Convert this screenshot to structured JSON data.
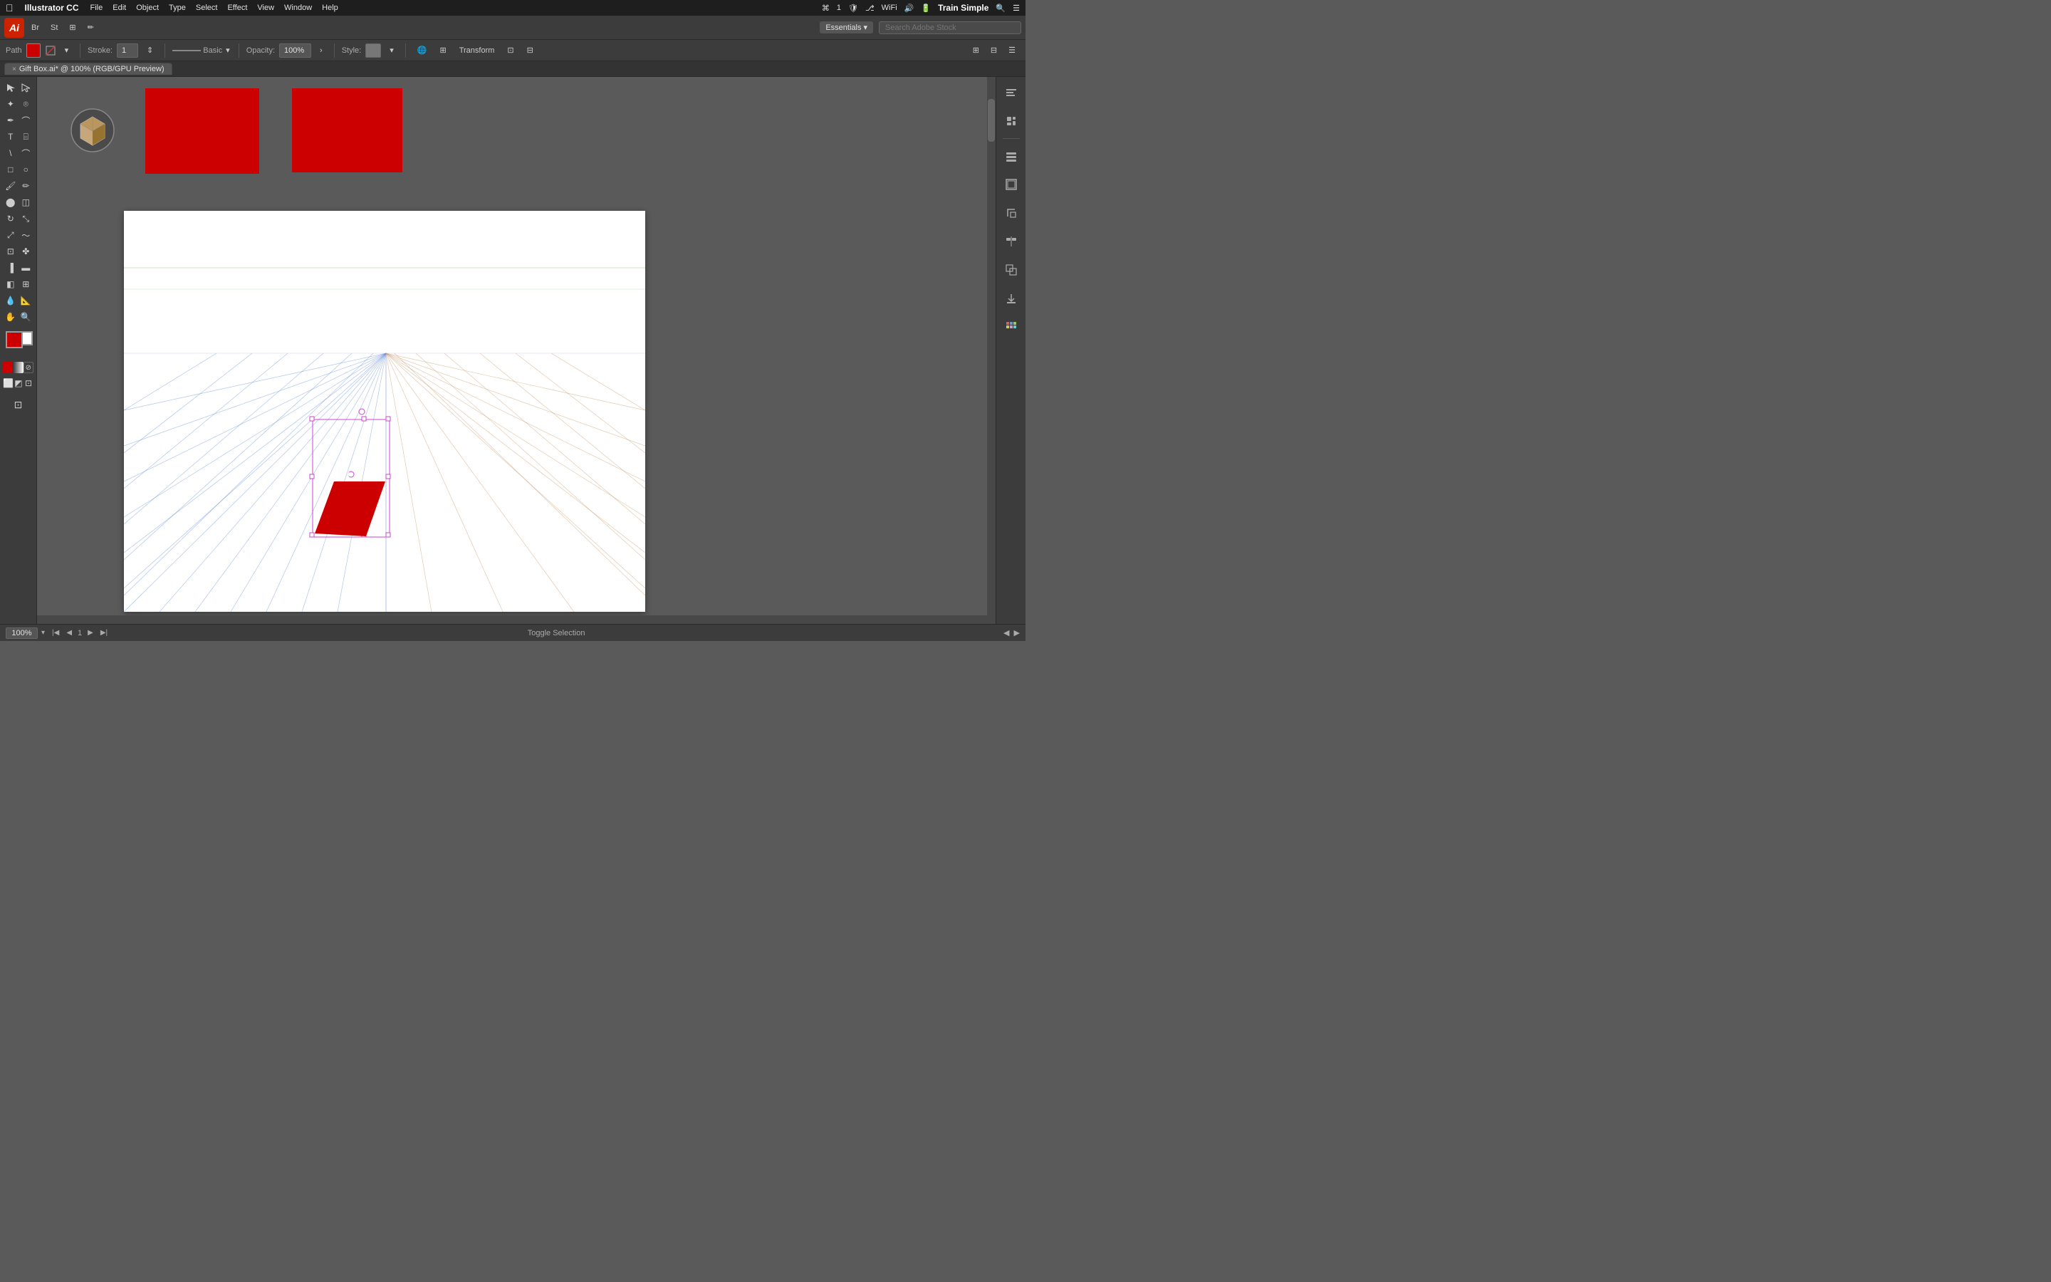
{
  "menubar": {
    "apple": "⌘",
    "app_name": "Illustrator CC",
    "menus": [
      "File",
      "Edit",
      "Object",
      "Type",
      "Select",
      "Effect",
      "View",
      "Window",
      "Help"
    ],
    "right": {
      "wifi": "WiFi",
      "battery": "🔋",
      "train_simple": "Train Simple",
      "search_icon": "🔍",
      "menu_icon": "☰"
    }
  },
  "top_toolbar": {
    "logo": "Ai",
    "bridge_btn": "Br",
    "stock_btn": "St",
    "arrange_btn": "⊞",
    "essentials_label": "Essentials",
    "search_placeholder": "Search Adobe Stock"
  },
  "properties_bar": {
    "label": "Path",
    "fill_color": "#cc0000",
    "stroke_label": "Stroke:",
    "stroke_value": "1",
    "stroke_type": "Basic",
    "opacity_label": "Opacity:",
    "opacity_value": "100%",
    "style_label": "Style:",
    "transform_btn": "Transform"
  },
  "tab": {
    "close": "×",
    "title": "Gift Box.ai* @ 100% (RGB/GPU Preview)"
  },
  "tools": [
    [
      "arrow-tool",
      "direct-select-tool"
    ],
    [
      "magic-wand",
      "lasso-tool"
    ],
    [
      "pen-tool",
      "curvature-tool"
    ],
    [
      "type-tool",
      "area-type-tool"
    ],
    [
      "line-tool",
      "arc-tool"
    ],
    [
      "rect-tool",
      "ellipse-tool"
    ],
    [
      "paintbrush",
      "pencil-tool"
    ],
    [
      "blob-brush",
      "eraser-tool"
    ],
    [
      "rotate-tool",
      "scale-tool"
    ],
    [
      "reshape-tool",
      "warp-tool"
    ],
    [
      "free-transform",
      "puppet-warp"
    ],
    [
      "column-chart",
      "bar-chart"
    ],
    [
      "gradient-tool",
      "mesh-tool"
    ],
    [
      "eyedropper",
      "measure-tool"
    ],
    [
      "hand-tool",
      "zoom-tool"
    ]
  ],
  "canvas": {
    "zoom_level": "100%",
    "page_num": "1",
    "artboard_width": 732,
    "artboard_height": 563,
    "status_action": "Toggle Selection"
  },
  "right_panel_icons": [
    "properties-icon",
    "libraries-icon",
    "layers-icon",
    "artboards-icon",
    "transform-icon",
    "align-icon",
    "pathfinder-icon",
    "asset-export-icon",
    "swatches-icon"
  ],
  "colors": {
    "red": "#cc0000",
    "white": "#ffffff",
    "dark_bg": "#3c3c3c",
    "canvas_bg": "#5a5a5a",
    "selection": "#cc44cc"
  }
}
